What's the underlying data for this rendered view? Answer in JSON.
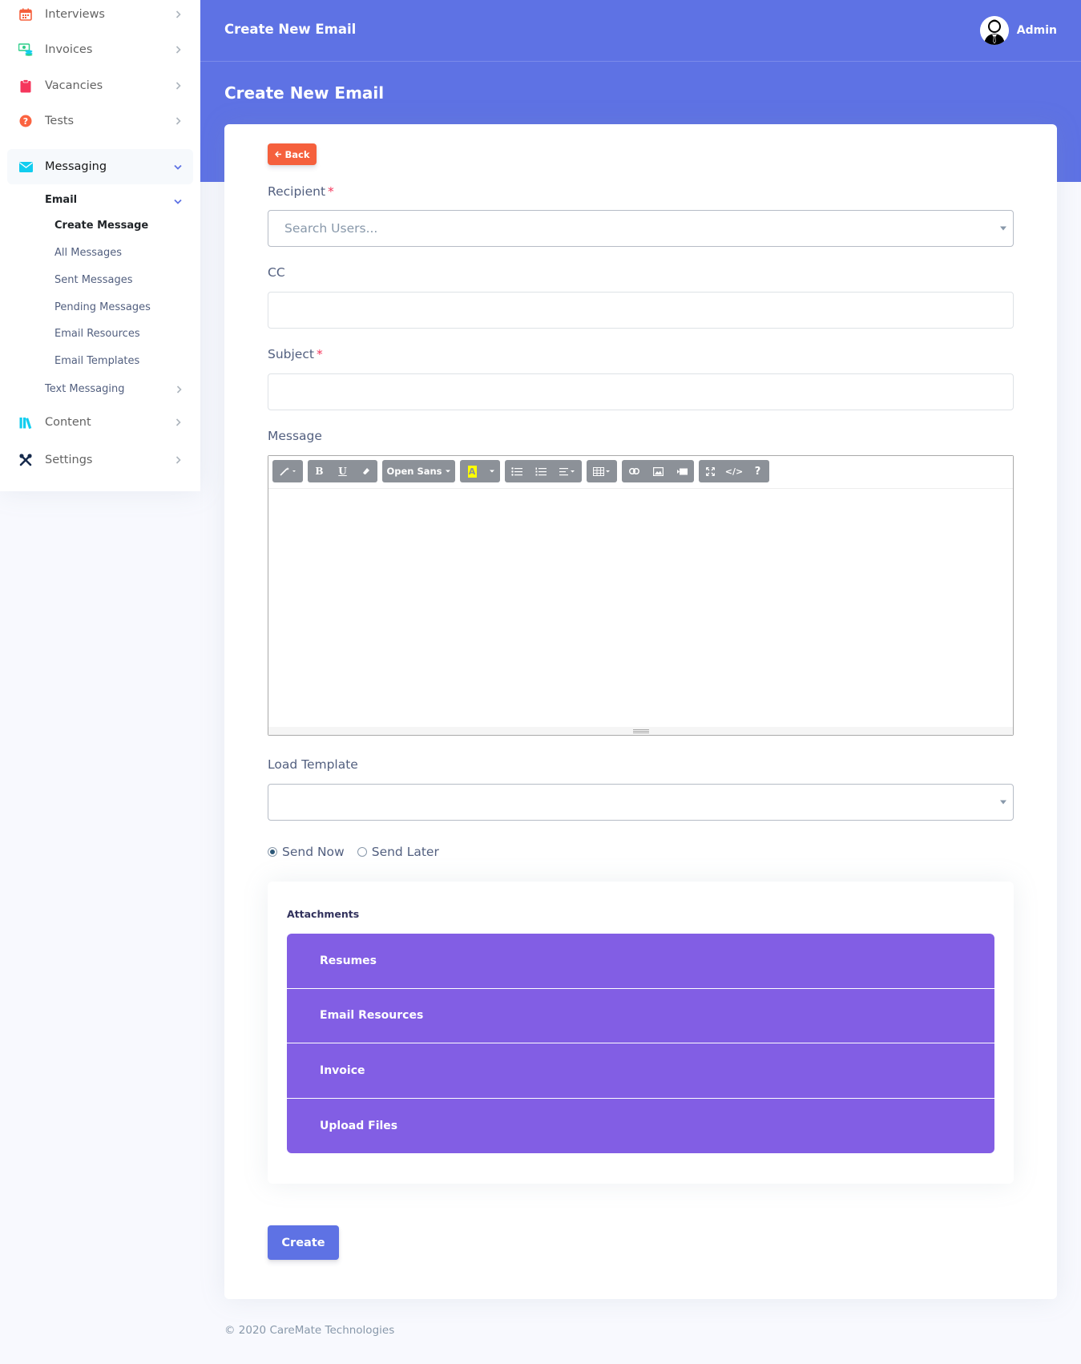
{
  "sidebar": {
    "items": [
      {
        "label": "Interviews",
        "icon": "calendar-icon",
        "color": "#f5603d"
      },
      {
        "label": "Invoices",
        "icon": "money-icon",
        "color": "#2dce89"
      },
      {
        "label": "Vacancies",
        "icon": "clipboard-icon",
        "color": "#f5365c"
      },
      {
        "label": "Tests",
        "icon": "question-circle-icon",
        "color": "#fb6340"
      },
      {
        "label": "Messaging",
        "icon": "envelope-icon",
        "color": "#11cdef"
      },
      {
        "label": "Content",
        "icon": "books-icon",
        "color": "#11cdef"
      },
      {
        "label": "Settings",
        "icon": "tools-icon",
        "color": "#172b4d"
      }
    ],
    "email_label": "Email",
    "email_items": [
      "Create Message",
      "All Messages",
      "Sent Messages",
      "Pending Messages",
      "Email Resources",
      "Email Templates"
    ],
    "text_messaging_label": "Text Messaging"
  },
  "topbar": {
    "title": "Create New Email",
    "user_name": "Admin"
  },
  "page": {
    "title": "Create New Email"
  },
  "form": {
    "back_label": "Back",
    "recipient_label": "Recipient",
    "recipient_placeholder": "Search Users...",
    "required_mark": "*",
    "cc_label": "CC",
    "subject_label": "Subject",
    "message_label": "Message",
    "toolbar_font": "Open Sans",
    "load_template_label": "Load Template",
    "send_now_label": "Send Now",
    "send_later_label": "Send Later",
    "send_mode_selected": "Send Now",
    "create_label": "Create"
  },
  "attachments": {
    "title": "Attachments",
    "items": [
      "Resumes",
      "Email Resources",
      "Invoice",
      "Upload Files"
    ]
  },
  "footer": {
    "text": "© 2020 CareMate Technologies"
  },
  "colors": {
    "primary": "#5e72e4",
    "back_button": "#f5603d",
    "attachment_accent": "#825ee4"
  }
}
